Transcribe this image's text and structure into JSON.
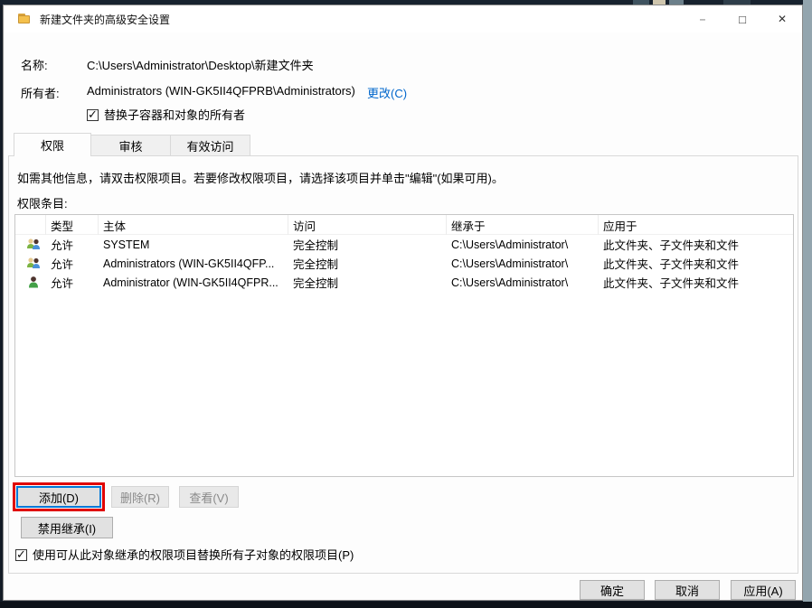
{
  "window": {
    "title": "新建文件夹的高级安全设置",
    "controls": {
      "minimize": "–",
      "maximize": "□",
      "close": "✕"
    }
  },
  "header": {
    "name_label": "名称:",
    "name_value": "C:\\Users\\Administrator\\Desktop\\新建文件夹",
    "owner_label": "所有者:",
    "owner_value": "Administrators (WIN-GK5II4QFPRB\\Administrators)",
    "change_link": "更改(C)",
    "replace_owner_checkbox_label": "替换子容器和对象的所有者",
    "replace_owner_checked": true
  },
  "tabs": [
    {
      "label": "权限",
      "active": true
    },
    {
      "label": "审核",
      "active": false
    },
    {
      "label": "有效访问",
      "active": false
    }
  ],
  "permissions_tab": {
    "instruction": "如需其他信息，请双击权限项目。若要修改权限项目，请选择该项目并单击\"编辑\"(如果可用)。",
    "entries_label": "权限条目:",
    "table": {
      "columns": [
        "类型",
        "主体",
        "访问",
        "继承于",
        "应用于"
      ],
      "rows": [
        {
          "icon": "users-group-icon",
          "type": "允许",
          "principal": "SYSTEM",
          "access": "完全控制",
          "inherited_from": "C:\\Users\\Administrator\\",
          "applies_to": "此文件夹、子文件夹和文件"
        },
        {
          "icon": "users-group-icon",
          "type": "允许",
          "principal": "Administrators (WIN-GK5II4QFP...",
          "access": "完全控制",
          "inherited_from": "C:\\Users\\Administrator\\",
          "applies_to": "此文件夹、子文件夹和文件"
        },
        {
          "icon": "user-icon",
          "type": "允许",
          "principal": "Administrator (WIN-GK5II4QFPR...",
          "access": "完全控制",
          "inherited_from": "C:\\Users\\Administrator\\",
          "applies_to": "此文件夹、子文件夹和文件"
        }
      ]
    },
    "buttons": {
      "add": "添加(D)",
      "remove": "删除(R)",
      "view": "查看(V)",
      "disable_inheritance": "禁用继承(I)"
    },
    "replace_child_checkbox_label": "使用可从此对象继承的权限项目替换所有子对象的权限项目(P)",
    "replace_child_checked": true
  },
  "footer": {
    "ok": "确定",
    "cancel": "取消",
    "apply": "应用(A)"
  },
  "colors": {
    "accent": "#0078d7",
    "link": "#0066cc",
    "highlight_red": "#e00000",
    "titlebar": "#ffffff"
  }
}
